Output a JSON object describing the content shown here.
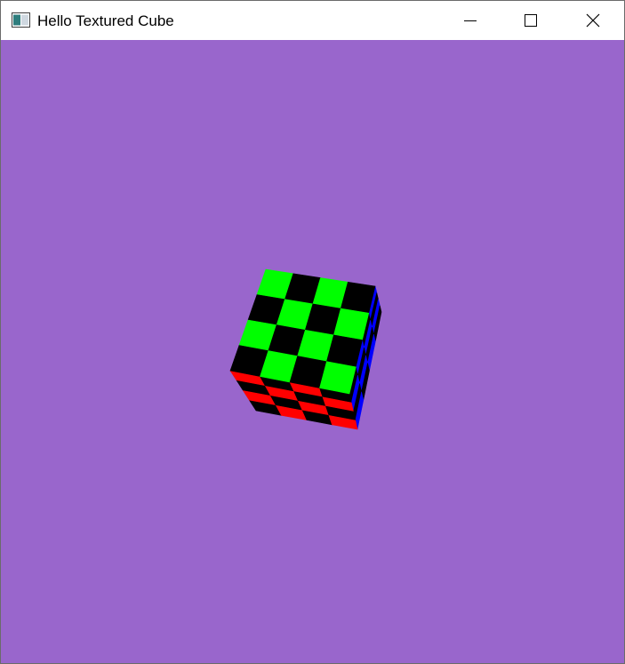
{
  "window": {
    "title": "Hello Textured Cube",
    "icon": "app-window-icon"
  },
  "caption_buttons": {
    "minimize": "minimize-icon",
    "maximize": "maximize-icon",
    "close": "close-icon"
  },
  "scene": {
    "background_color": "#9966cc",
    "object": "textured-cube",
    "checker_dark": "#000000",
    "face_colors": {
      "top": "#00ff00",
      "front": "#ff0000",
      "right": "#0000ff"
    },
    "checker_divisions": 4
  }
}
